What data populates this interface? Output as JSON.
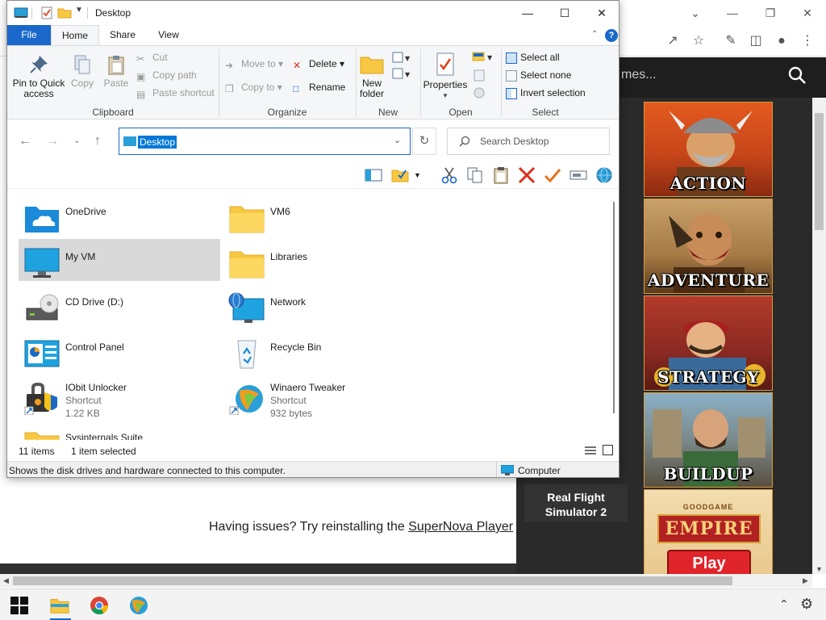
{
  "explorer": {
    "title": "Desktop",
    "tabs": {
      "file": "File",
      "home": "Home",
      "share": "Share",
      "view": "View"
    },
    "ribbon": {
      "clipboard": {
        "label": "Clipboard",
        "pin": "Pin to Quick access",
        "copy": "Copy",
        "paste": "Paste",
        "cut": "Cut",
        "copy_path": "Copy path",
        "paste_shortcut": "Paste shortcut"
      },
      "organize": {
        "label": "Organize",
        "move_to": "Move to",
        "copy_to": "Copy to",
        "delete": "Delete",
        "rename": "Rename"
      },
      "new": {
        "label": "New",
        "new_folder": "New folder"
      },
      "open": {
        "label": "Open",
        "properties": "Properties"
      },
      "select": {
        "label": "Select",
        "select_all": "Select all",
        "select_none": "Select none",
        "invert": "Invert selection"
      }
    },
    "address": {
      "value": "Desktop"
    },
    "search": {
      "placeholder": "Search Desktop"
    },
    "items": [
      {
        "name": "OneDrive",
        "icon": "onedrive-icon"
      },
      {
        "name": "VM6",
        "icon": "folder-icon"
      },
      {
        "name": "My VM",
        "icon": "computer-icon",
        "selected": true
      },
      {
        "name": "Libraries",
        "icon": "libraries-icon"
      },
      {
        "name": "CD Drive (D:)",
        "icon": "cd-drive-icon"
      },
      {
        "name": "Network",
        "icon": "network-icon"
      },
      {
        "name": "Control Panel",
        "icon": "control-panel-icon"
      },
      {
        "name": "Recycle Bin",
        "icon": "recycle-bin-icon"
      },
      {
        "name": "IObit Unlocker",
        "icon": "iobit-unlocker-icon",
        "type": "Shortcut",
        "size": "1.22 KB"
      },
      {
        "name": "Winaero Tweaker",
        "icon": "winaero-tweaker-icon",
        "type": "Shortcut",
        "size": "932 bytes"
      },
      {
        "name": "Sysinternals Suite",
        "icon": "folder-icon"
      }
    ],
    "status": {
      "count": "11 items",
      "selected": "1 item selected"
    },
    "tip": {
      "text": "Shows the disk drives and hardware connected to this computer.",
      "location": "Computer"
    }
  },
  "browser": {
    "search_text": "mes...",
    "games": [
      "ACTION",
      "ADVENTURE",
      "STRATEGY",
      "BUILDUP"
    ],
    "empire": {
      "brand": "GOODGAME",
      "title": "EMPIRE",
      "play": "Play"
    },
    "flight": {
      "line1": "Real Flight",
      "line2": "Simulator 2"
    },
    "issues": {
      "prefix": "Having issues? Try reinstalling the ",
      "link": "SuperNova Player"
    }
  },
  "colors": {
    "accent": "#1a68c9",
    "selection": "#0078d7",
    "folder": "#f8c842"
  }
}
